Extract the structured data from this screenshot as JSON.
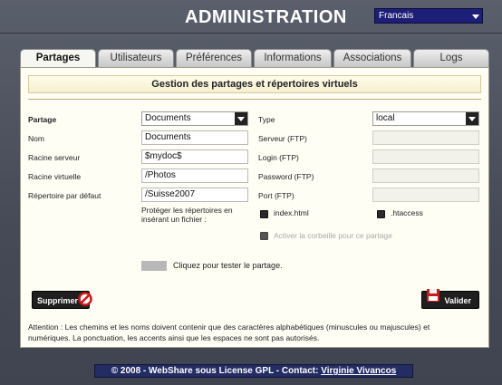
{
  "app": {
    "title": "ADMINISTRATION"
  },
  "language": {
    "selected": "Francais"
  },
  "tabs": [
    {
      "label": "Partages",
      "active": true
    },
    {
      "label": "Utilisateurs"
    },
    {
      "label": "Préférences"
    },
    {
      "label": "Informations"
    },
    {
      "label": "Associations"
    },
    {
      "label": "Logs"
    }
  ],
  "section": {
    "title": "Gestion des partages et répertoires virtuels"
  },
  "form": {
    "share_label": "Partage",
    "share_value": "Documents",
    "name_label": "Nom",
    "name_value": "Documents",
    "root_server_label": "Racine serveur",
    "root_server_value": "$mydoc$",
    "virtual_root_label": "Racine virtuelle",
    "virtual_root_value": "/Photos",
    "default_dir_label": "Répertoire par défaut",
    "default_dir_value": "/Suisse2007",
    "type_label": "Type",
    "type_value": "local",
    "ftp_server_label": "Serveur (FTP)",
    "ftp_login_label": "Login (FTP)",
    "ftp_password_label": "Password (FTP)",
    "ftp_port_label": "Port (FTP)",
    "protect_label_line1": "Protéger les répertoires en",
    "protect_label_line2": "insérant un fichier :",
    "opt_index": "index.html",
    "opt_htaccess": ".htaccess",
    "opt_recycle": "Activer la corbeille pour ce partage",
    "test_link": "Cliquez pour tester le partage."
  },
  "buttons": {
    "delete": "Supprimer",
    "save": "Valider"
  },
  "notice_line1": "Attention : Les chemins et les noms doivent contenir que des caractères alphabétiques (minuscules ou majuscules) et",
  "notice_line2": "numériques. La ponctuation, les accents ainsi que les espaces ne sont pas autorisés.",
  "footer": {
    "text": "© 2008 - WebShare sous License GPL - Contact:",
    "author": "Virginie Vivancos"
  },
  "colors": {
    "accent": "#1d1e77",
    "footer": "#232c63",
    "panel": "#fffef5"
  }
}
